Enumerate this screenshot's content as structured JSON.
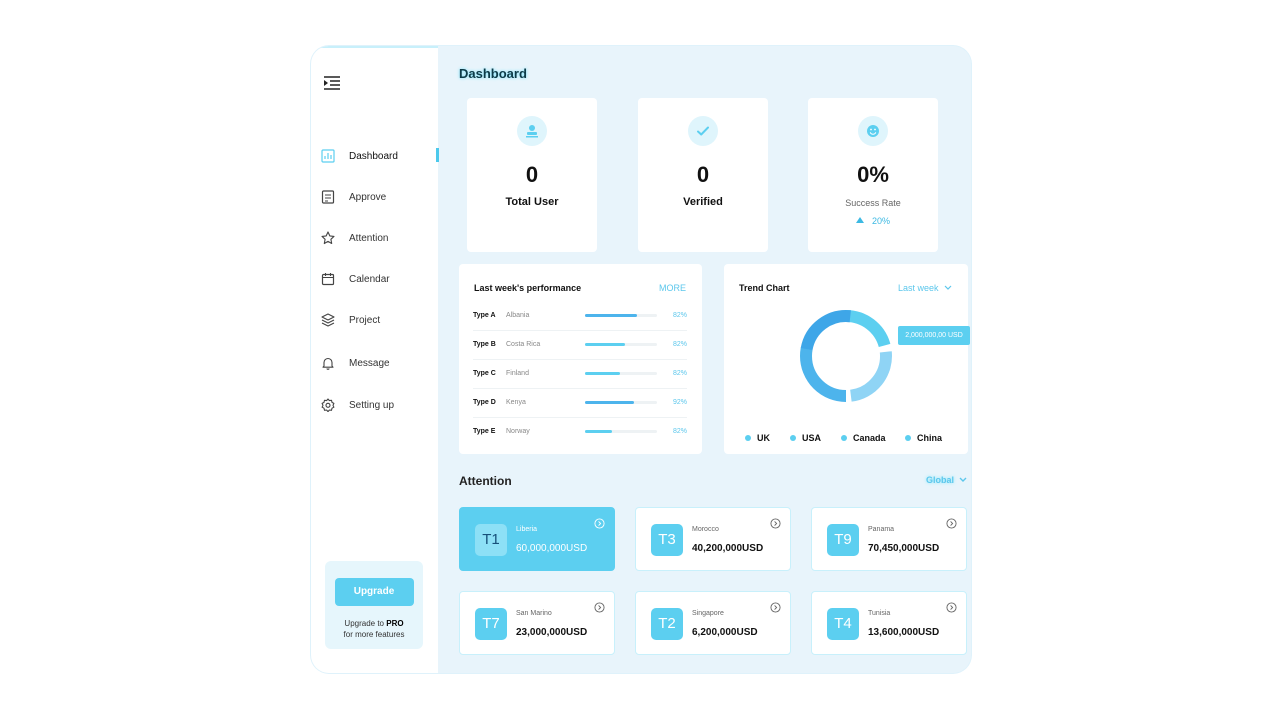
{
  "sidebar": {
    "items": [
      {
        "label": "Dashboard",
        "icon": "chart-icon",
        "active": true
      },
      {
        "label": "Approve",
        "icon": "document-icon"
      },
      {
        "label": "Attention",
        "icon": "star-icon"
      },
      {
        "label": "Calendar",
        "icon": "calendar-icon"
      },
      {
        "label": "Project",
        "icon": "layers-icon"
      },
      {
        "label": "Message",
        "icon": "bell-icon"
      },
      {
        "label": "Setting up",
        "icon": "gear-icon"
      }
    ],
    "upgrade": {
      "button": "Upgrade",
      "line1_prefix": "Upgrade to ",
      "line1_bold": "PRO",
      "line2": "for more features"
    }
  },
  "header": {
    "title": "Dashboard"
  },
  "stats": [
    {
      "value": "0",
      "label": "Total User",
      "icon": "user-stamp-icon"
    },
    {
      "value": "0",
      "label": "Verified",
      "icon": "check-icon"
    },
    {
      "value": "0%",
      "label": "Success Rate",
      "trend": "20%",
      "icon": "smile-icon"
    }
  ],
  "performance": {
    "title": "Last week's performance",
    "more": "MORE",
    "rows": [
      {
        "type": "Type A",
        "country": "Albania",
        "pct": "82%",
        "fill": 0.72
      },
      {
        "type": "Type B",
        "country": "Costa Rica",
        "pct": "82%",
        "fill": 0.55
      },
      {
        "type": "Type C",
        "country": "Finland",
        "pct": "82%",
        "fill": 0.48
      },
      {
        "type": "Type D",
        "country": "Kenya",
        "pct": "92%",
        "fill": 0.68
      },
      {
        "type": "Type E",
        "country": "Norway",
        "pct": "82%",
        "fill": 0.38
      }
    ]
  },
  "trend": {
    "title": "Trend Chart",
    "range": "Last week",
    "tooltip": "2,000,000,00 USD",
    "legend": [
      "UK",
      "USA",
      "Canada",
      "China"
    ]
  },
  "attention": {
    "title": "Attention",
    "filter": "Global",
    "cards": [
      {
        "code": "T1",
        "country": "Liberia",
        "amount": "60,000,000USD",
        "active": true
      },
      {
        "code": "T3",
        "country": "Morocco",
        "amount": "40,200,000USD"
      },
      {
        "code": "T9",
        "country": "Panama",
        "amount": "70,450,000USD"
      },
      {
        "code": "T7",
        "country": "San Marino",
        "amount": "23,000,000USD"
      },
      {
        "code": "T2",
        "country": "Singapore",
        "amount": "6,200,000USD"
      },
      {
        "code": "T4",
        "country": "Tunisia",
        "amount": "13,600,000USD"
      }
    ]
  },
  "colors": {
    "accent": "#5ccff0",
    "accent_dark": "#3ca9e3",
    "bg": "#e8f4fb"
  }
}
